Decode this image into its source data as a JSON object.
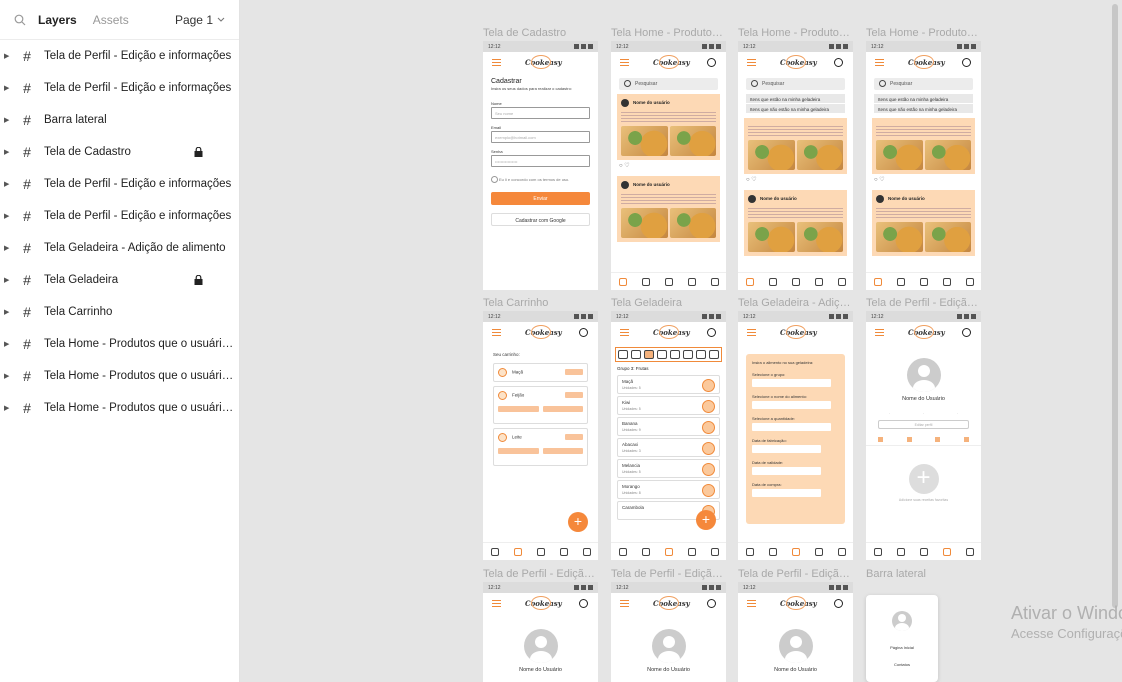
{
  "sidebar": {
    "tab_layers": "Layers",
    "tab_assets": "Assets",
    "page": "Page 1",
    "layers": [
      {
        "name": "Tela de Perfil - Edição e informações",
        "locked": false
      },
      {
        "name": "Tela de Perfil - Edição e informações",
        "locked": false
      },
      {
        "name": "Barra lateral",
        "locked": false
      },
      {
        "name": "Tela de Cadastro",
        "locked": true
      },
      {
        "name": "Tela de Perfil - Edição e informações",
        "locked": false
      },
      {
        "name": "Tela de Perfil - Edição e informações",
        "locked": false
      },
      {
        "name": "Tela Geladeira - Adição de alimento",
        "locked": false
      },
      {
        "name": "Tela Geladeira",
        "locked": true
      },
      {
        "name": "Tela Carrinho",
        "locked": false
      },
      {
        "name": "Tela Home - Produtos que o usuário...",
        "locked": false
      },
      {
        "name": "Tela Home - Produtos que o usuário...",
        "locked": false
      },
      {
        "name": "Tela Home - Produtos que o usuário...",
        "locked": false
      }
    ]
  },
  "frames": {
    "row1": [
      "Tela de Cadastro",
      "Tela Home - Produtos...",
      "Tela Home - Produtos...",
      "Tela Home - Produtos..."
    ],
    "row2": [
      "Tela Carrinho",
      "Tela Geladeira",
      "Tela Geladeira - Adição...",
      "Tela de Perfil - Edição..."
    ],
    "row3": [
      "Tela de Perfil - Edição...",
      "Tela de Perfil - Edição...",
      "Tela de Perfil - Edição...",
      "Barra lateral"
    ]
  },
  "mock": {
    "time": "12:12",
    "logo": "Cookeasy",
    "signup": {
      "title": "Cadastrar",
      "subtitle": "Insira os seus dados para realizar o cadastro:",
      "name_label": "Nome",
      "name_ph": "Seu nome",
      "email_label": "Email",
      "email_ph": "exemplo@hotmail.com",
      "pass_label": "Senha",
      "pass_ph": "••••••••••••••••",
      "terms": "Eu li e concordo com os termos de uso.",
      "submit": "Enviar",
      "google": "Cadastrar com Google"
    },
    "search": "Pesquisar",
    "drop1": "Itens que estão na minha geladeira",
    "drop2": "Itens que não estão na minha geladeira",
    "username": "Nome do usuário",
    "cart": {
      "title": "Seu carrinho:",
      "item1": "Maçã",
      "item2": "Feijão",
      "item3": "Leite"
    },
    "fridge": {
      "group": "Grupo 3: Frutas",
      "items": [
        {
          "name": "Maçã",
          "qty": "Unidades: 5"
        },
        {
          "name": "Kiwi",
          "qty": "Unidades: 5"
        },
        {
          "name": "Banana",
          "qty": "Unidades: 9"
        },
        {
          "name": "Abacaxi",
          "qty": "Unidades: 3"
        },
        {
          "name": "Melancia",
          "qty": "Unidades: 5"
        },
        {
          "name": "Morango",
          "qty": "Unidades: 8"
        },
        {
          "name": "Carambola",
          "qty": ""
        }
      ]
    },
    "add_food": {
      "title": "Insira o alimento no sua geladeira:",
      "l1": "Selecione o grupo:",
      "l2": "Selecione o nome do alimento:",
      "l3": "Selecione a quantidade:",
      "l4": "Data de fabricação:",
      "l5": "Data de validade:",
      "l6": "Data de compra:"
    },
    "profile": {
      "name": "Nome do Usuário",
      "edit": "Editar perfil",
      "add": "Adicione suas receitas favoritas"
    },
    "side": {
      "home": "Página Inicial",
      "contacts": "Contatos"
    }
  },
  "watermark": {
    "line1": "Ativar o Windows",
    "line2": "Acesse Configurações para ativar o Windows."
  }
}
